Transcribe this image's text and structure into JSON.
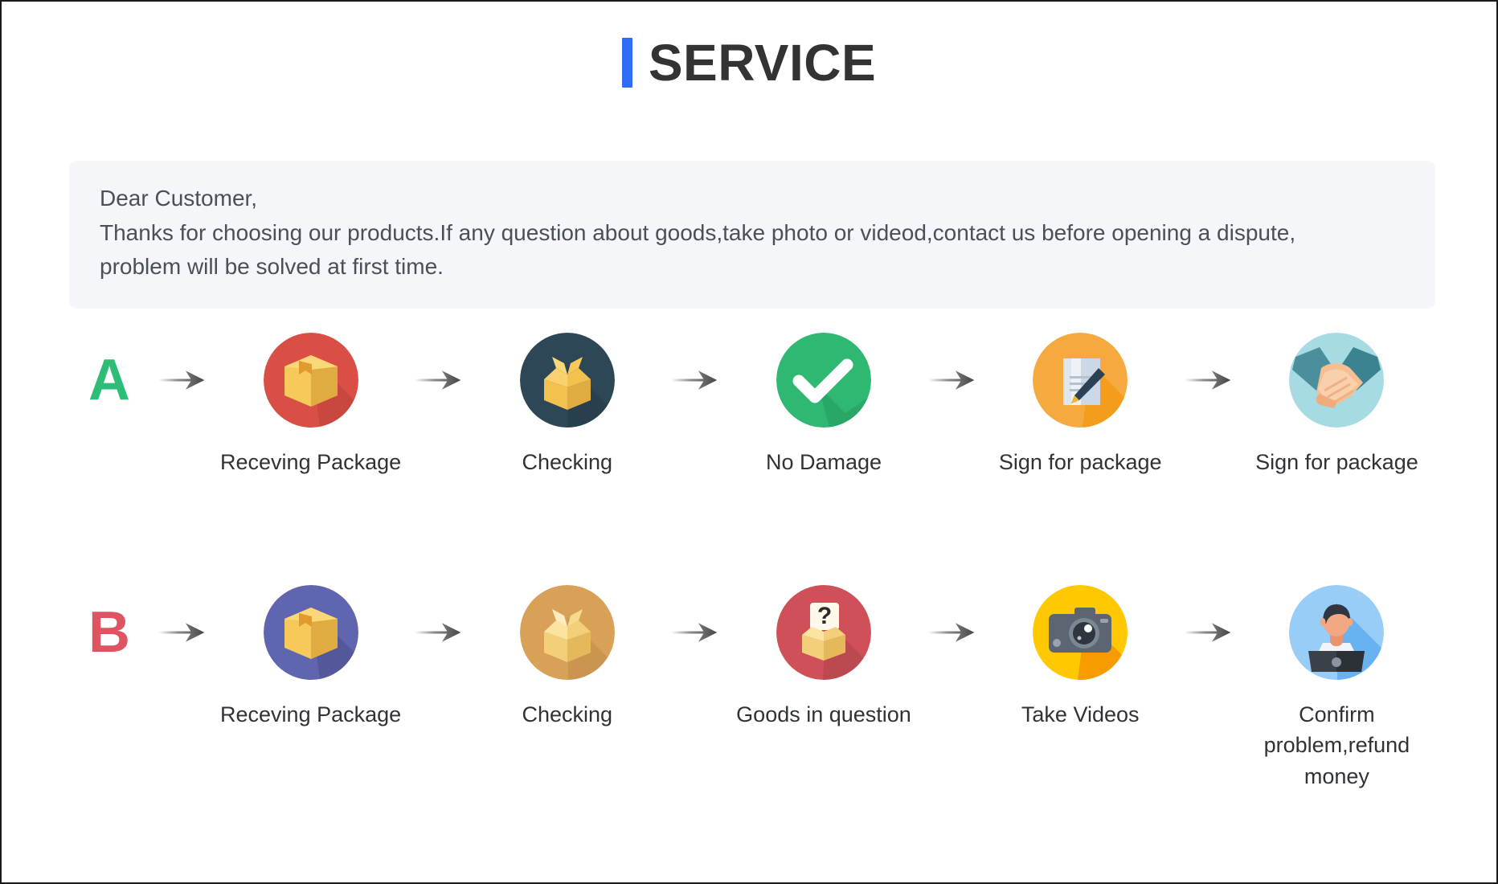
{
  "header": {
    "title": "SERVICE",
    "accent_color": "#2f6df6"
  },
  "notice": {
    "line1": "Dear Customer,",
    "line2": "Thanks for choosing our products.If any question about goods,take photo or videod,contact us before opening a dispute,",
    "line3": "problem will be solved at first time."
  },
  "flows": [
    {
      "letter": "A",
      "letter_color": "#2ebd77",
      "steps": [
        {
          "label": "Receving Package",
          "icon": "package-box-icon",
          "circle_color": "#d94f45"
        },
        {
          "label": "Checking",
          "icon": "open-box-icon",
          "circle_color": "#2d4757"
        },
        {
          "label": "No Damage",
          "icon": "check-mark-icon",
          "circle_color": "#2eb872"
        },
        {
          "label": "Sign for package",
          "icon": "document-pen-icon",
          "circle_color": "#f5a93f"
        },
        {
          "label": "Sign for package",
          "icon": "handshake-icon",
          "circle_color": "#a6dbe3"
        }
      ]
    },
    {
      "letter": "B",
      "letter_color": "#dd5560",
      "steps": [
        {
          "label": "Receving Package",
          "icon": "package-box-icon",
          "circle_color": "#6065b0"
        },
        {
          "label": "Checking",
          "icon": "open-box-icon",
          "circle_color": "#d9a158"
        },
        {
          "label": "Goods in question",
          "icon": "question-box-icon",
          "circle_color": "#cf5058"
        },
        {
          "label": "Take Videos",
          "icon": "camera-icon",
          "circle_color": "#ffc800"
        },
        {
          "label": "Confirm problem,refund money",
          "icon": "support-agent-icon",
          "circle_color": "#97cdf7"
        }
      ]
    }
  ]
}
